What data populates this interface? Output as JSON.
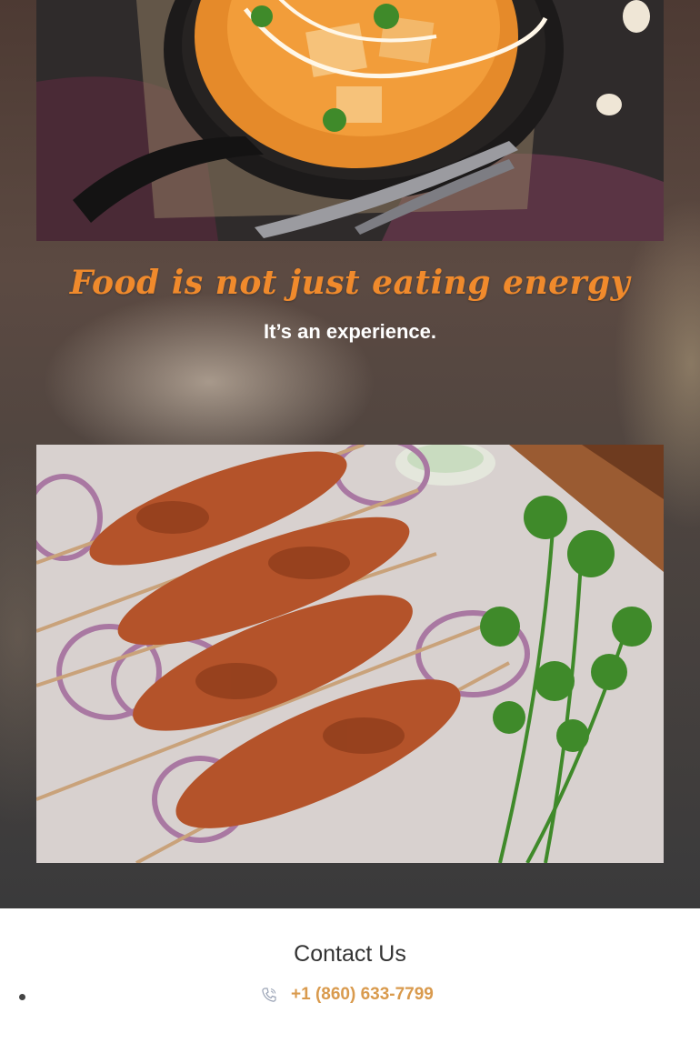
{
  "hero": {
    "headline": "Food is not just eating energy",
    "subline": "It’s an experience."
  },
  "images": {
    "top": "paneer curry in cast iron skillet",
    "bottom": "chicken tikka skewers with onion rings and cilantro"
  },
  "contact": {
    "title": "Contact Us",
    "items": [
      {
        "icon": "phone-icon",
        "label": "+1 (860) 633-7799"
      }
    ]
  },
  "colors": {
    "accent": "#f08a2c",
    "phone": "#d99a4d",
    "title": "#333333"
  }
}
